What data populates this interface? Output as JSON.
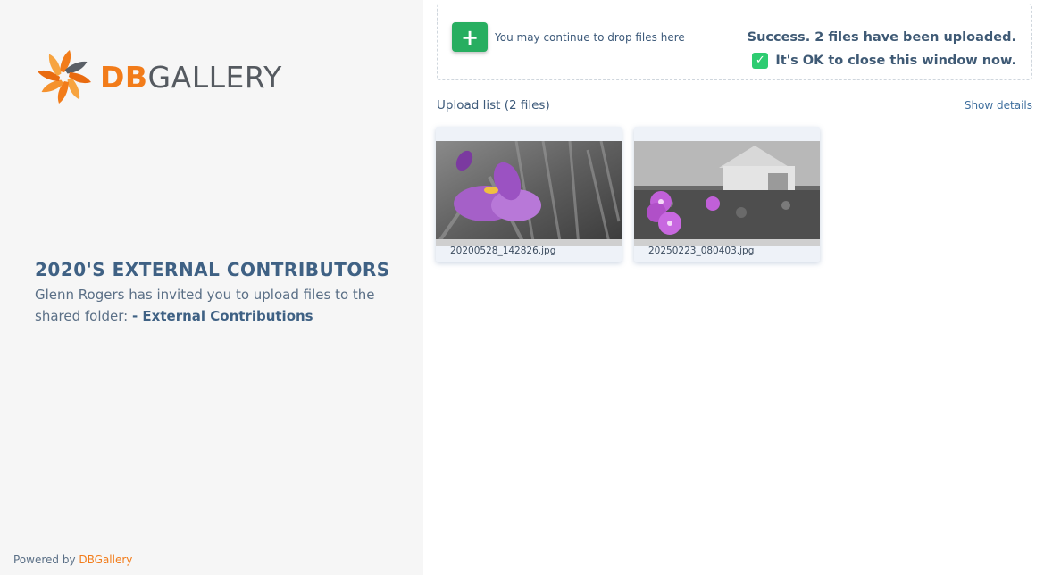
{
  "brand": {
    "logo_db": "DB",
    "logo_gallery": "GALLERY",
    "logo_icon": "sunburst-logo-icon",
    "accent_color": "#f27c1a"
  },
  "invite": {
    "title": "2020'S EXTERNAL CONTRIBUTORS",
    "text": "Glenn Rogers has invited you to upload files to the shared folder:",
    "folder": "- External Contributions"
  },
  "dropzone": {
    "add_icon": "plus-icon",
    "hint": "You may continue to drop files here",
    "success_message": "Success. 2 files have been uploaded.",
    "ok_message": "It's OK to close this window now.",
    "success_color": "#27ae60"
  },
  "upload_list": {
    "header": "Upload list (2 files)",
    "show_details": "Show details",
    "files": [
      {
        "name": "20200528_142826.jpg"
      },
      {
        "name": "20250223_080403.jpg"
      }
    ]
  },
  "footer": {
    "powered_by": "Powered by",
    "powered_link": "DBGallery"
  }
}
